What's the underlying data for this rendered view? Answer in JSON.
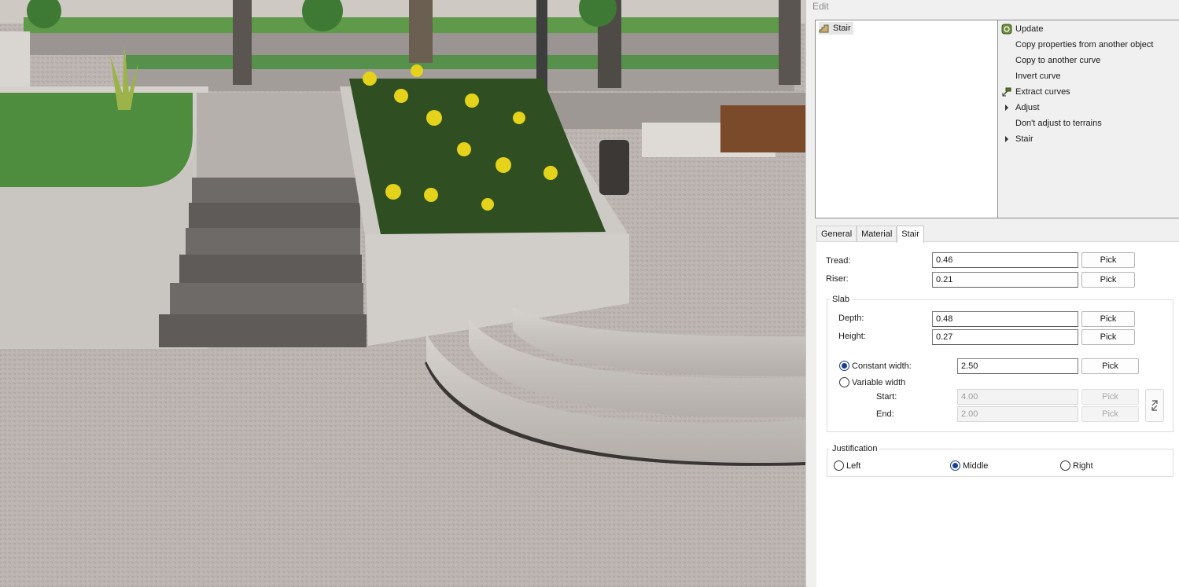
{
  "panel": {
    "title": "Edit"
  },
  "tree": {
    "items": [
      {
        "label": "Stair",
        "icon": "stair-icon"
      }
    ]
  },
  "actions": [
    {
      "label": "Update",
      "icon": "update-icon"
    },
    {
      "label": "Copy properties from another object",
      "icon": ""
    },
    {
      "label": "Copy to another curve",
      "icon": ""
    },
    {
      "label": "Invert curve",
      "icon": ""
    },
    {
      "label": "Extract curves",
      "icon": "extract-curves-icon"
    },
    {
      "label": "Adjust",
      "icon": "expand-arrow-icon"
    },
    {
      "label": "Don't adjust to terrains",
      "icon": ""
    },
    {
      "label": "Stair",
      "icon": "expand-arrow-icon"
    }
  ],
  "tabs": [
    {
      "label": "General"
    },
    {
      "label": "Material"
    },
    {
      "label": "Stair",
      "active": true
    }
  ],
  "stair": {
    "tread": {
      "label": "Tread:",
      "value": "0.46",
      "pick": "Pick"
    },
    "riser": {
      "label": "Riser:",
      "value": "0.21",
      "pick": "Pick"
    },
    "slab": {
      "title": "Slab",
      "depth": {
        "label": "Depth:",
        "value": "0.48",
        "pick": "Pick"
      },
      "height": {
        "label": "Height:",
        "value": "0.27",
        "pick": "Pick"
      },
      "constant_width": {
        "label": "Constant width:",
        "value": "2.50",
        "pick": "Pick",
        "selected": true
      },
      "variable_width": {
        "label": "Variable width",
        "selected": false
      },
      "start": {
        "label": "Start:",
        "value": "4.00",
        "pick": "Pick"
      },
      "end": {
        "label": "End:",
        "value": "2.00",
        "pick": "Pick"
      }
    },
    "justification": {
      "title": "Justification",
      "options": [
        {
          "label": "Left",
          "selected": false
        },
        {
          "label": "Middle",
          "selected": true
        },
        {
          "label": "Right",
          "selected": false
        }
      ]
    }
  },
  "colors": {
    "accent": "#1b3d8c",
    "grass": "#4a8a3c",
    "paving": "#b9b3b0",
    "flower": "#e5d21a"
  }
}
